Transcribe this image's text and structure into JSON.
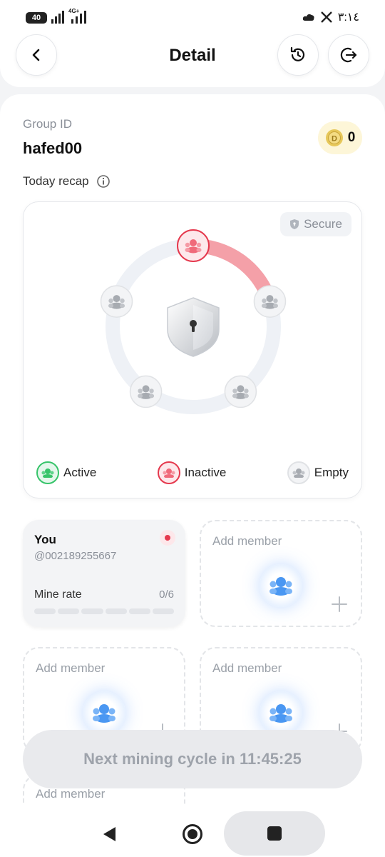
{
  "status_bar": {
    "battery": "40",
    "network": "4G+",
    "time": "٣:١٤"
  },
  "header": {
    "title": "Detail"
  },
  "group": {
    "label": "Group ID",
    "id": "hafed00",
    "coins": "0"
  },
  "recap": {
    "title": "Today recap",
    "secure_label": "Secure",
    "legend": {
      "active": "Active",
      "inactive": "Inactive",
      "empty": "Empty"
    },
    "slots": [
      "inactive",
      "empty",
      "empty",
      "empty",
      "empty"
    ],
    "progress": 0.2
  },
  "you_card": {
    "name": "You",
    "handle": "@002189255667",
    "mine_rate_label": "Mine rate",
    "mine_rate_value": "0/6",
    "mine_rate_fraction": 0
  },
  "add_member": {
    "label": "Add member"
  },
  "cycle": {
    "text": "Next mining cycle in 11:45:25"
  },
  "colors": {
    "active": "#37c46a",
    "inactive": "#e5384d",
    "empty": "#9ca0a6",
    "accent_blue": "#3b8df0"
  }
}
